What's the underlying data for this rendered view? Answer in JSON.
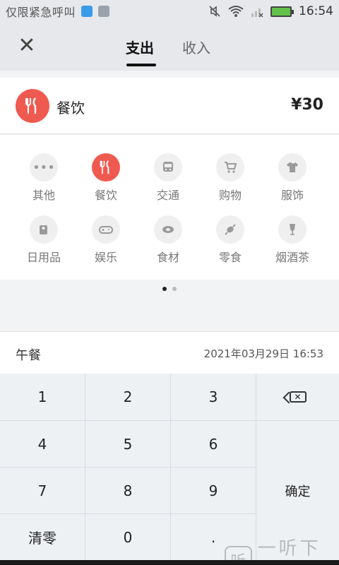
{
  "status_bar": {
    "carrier": "仅限紧急呼叫",
    "time": "16:54",
    "icons": [
      "usb-icon",
      "image-notification-icon",
      "mute-icon",
      "wifi-icon",
      "no-signal-icon",
      "battery-charging-icon"
    ]
  },
  "header": {
    "close_icon": "close-icon",
    "tabs": [
      {
        "label": "支出",
        "active": true
      },
      {
        "label": "收入",
        "active": false
      }
    ]
  },
  "selected_category": {
    "name": "餐饮",
    "amount": "¥30",
    "icon": "fork-knife-icon",
    "color": "#ef5a50"
  },
  "categories": [
    {
      "label": "其他",
      "icon": "more-icon",
      "active": false
    },
    {
      "label": "餐饮",
      "icon": "fork-knife-icon",
      "active": true
    },
    {
      "label": "交通",
      "icon": "bus-icon",
      "active": false
    },
    {
      "label": "购物",
      "icon": "cart-icon",
      "active": false
    },
    {
      "label": "服饰",
      "icon": "shirt-icon",
      "active": false
    },
    {
      "label": "日用品",
      "icon": "tissue-roll-icon",
      "active": false
    },
    {
      "label": "娱乐",
      "icon": "gamepad-icon",
      "active": false
    },
    {
      "label": "食材",
      "icon": "meat-icon",
      "active": false
    },
    {
      "label": "零食",
      "icon": "candy-icon",
      "active": false
    },
    {
      "label": "烟酒茶",
      "icon": "wine-glass-icon",
      "active": false
    }
  ],
  "pager": {
    "pages": 2,
    "current": 1
  },
  "note_bar": {
    "note": "午餐",
    "datetime": "2021年03月29日 16:53"
  },
  "keypad": {
    "keys": [
      "1",
      "2",
      "3",
      "4",
      "5",
      "6",
      "7",
      "8",
      "9",
      "清零",
      "0",
      "."
    ],
    "backspace_icon": "backspace-icon",
    "confirm": "确定"
  },
  "watermark": {
    "logo": "听",
    "text": "一听下载"
  }
}
